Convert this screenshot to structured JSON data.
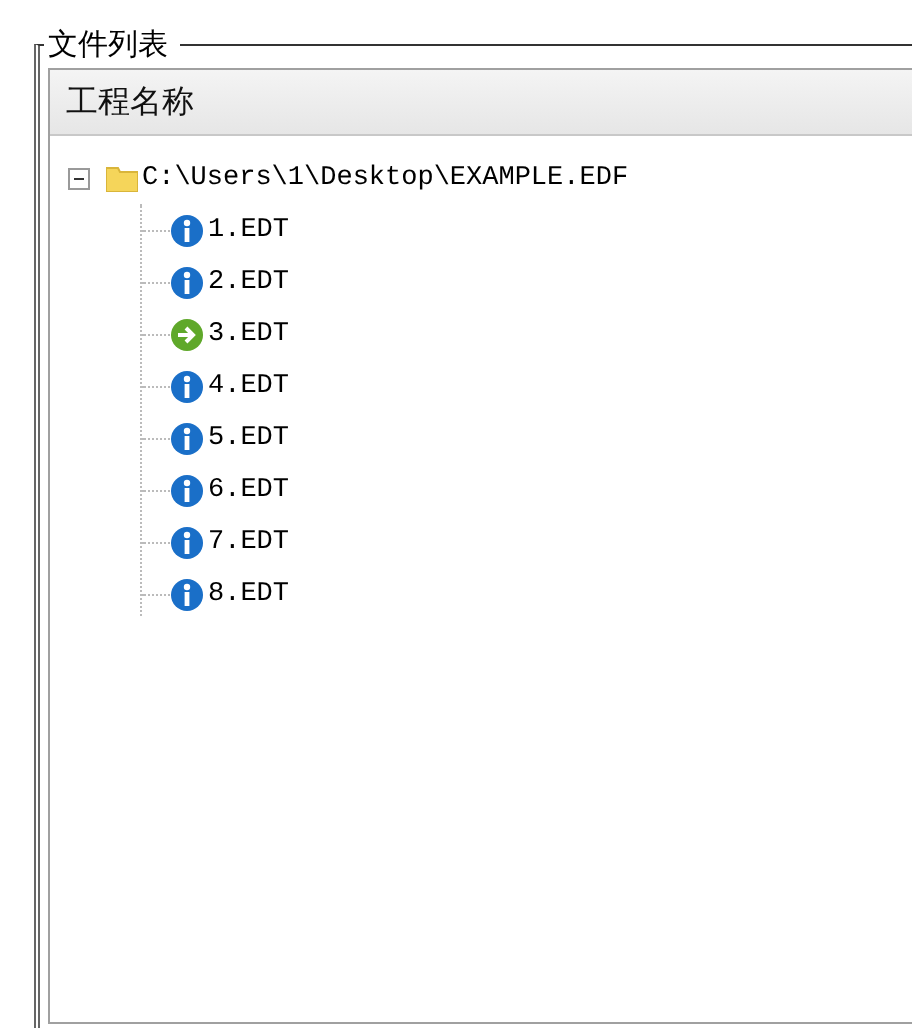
{
  "group_title": "文件列表",
  "header": {
    "label": "工程名称"
  },
  "tree": {
    "label": "C:\\Users\\1\\Desktop\\EXAMPLE.EDF",
    "expanded": true,
    "children": [
      {
        "label": "1.EDT",
        "kind": "info"
      },
      {
        "label": "2.EDT",
        "kind": "info"
      },
      {
        "label": "3.EDT",
        "kind": "current"
      },
      {
        "label": "4.EDT",
        "kind": "info"
      },
      {
        "label": "5.EDT",
        "kind": "info"
      },
      {
        "label": "6.EDT",
        "kind": "info"
      },
      {
        "label": "7.EDT",
        "kind": "info"
      },
      {
        "label": "8.EDT",
        "kind": "info"
      }
    ]
  }
}
